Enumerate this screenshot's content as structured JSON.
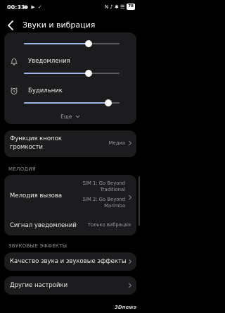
{
  "status_bar": {
    "time": "00:33",
    "left_icons": "● ▶ ✓",
    "right_icons": "N ♪ ✱ ☰",
    "battery": "78"
  },
  "header": {
    "title": "Звуки и вибрация"
  },
  "volume": {
    "sliders": [
      {
        "label": "",
        "level": 0.68,
        "icon": "music-icon"
      },
      {
        "label": "Уведомления",
        "level": 0.68,
        "icon": "bell-icon"
      },
      {
        "label": "Будильник",
        "level": 0.88,
        "icon": "alarm-clock-icon"
      }
    ],
    "more_label": "Еще"
  },
  "volume_buttons": {
    "title": "Функция кнопок громкости",
    "value": "Медиа"
  },
  "melody": {
    "section_title": "МЕЛОДИЯ",
    "ringtone": {
      "title": "Мелодия вызова",
      "sim1": "SIM 1: Go Beyond Traditional",
      "sim2": "SIM 2: Go Beyond Marimba"
    },
    "notification": {
      "title": "Сигнал уведомлений",
      "value": "Только вибрация"
    }
  },
  "sound_effects": {
    "section_title": "ЗВУКОВЫЕ ЭФФЕКТЫ",
    "quality": {
      "title": "Качество звука и звуковые эффекты"
    }
  },
  "other_settings": {
    "title": "Другие настройки"
  },
  "watermark": "3Dnews",
  "colors": {
    "background": "#000000",
    "card": "#1c1c1e",
    "accent_fill": "#9db7e6",
    "secondary_text": "#9a9a9e"
  }
}
